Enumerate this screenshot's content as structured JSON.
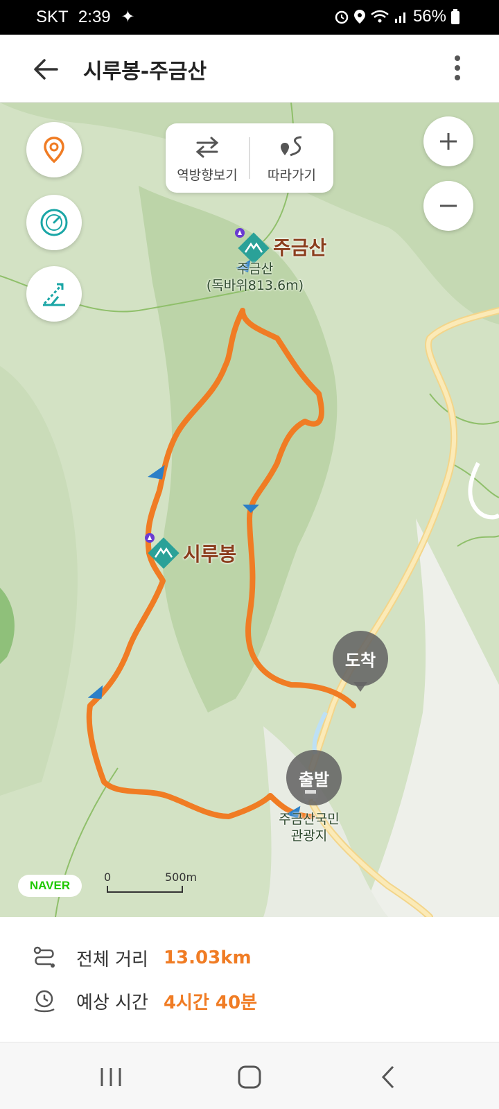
{
  "status": {
    "carrier": "SKT",
    "time": "2:39",
    "battery": "56%"
  },
  "header": {
    "title": "시루봉-주금산"
  },
  "map": {
    "toolbar": {
      "reverse_label": "역방향보기",
      "follow_label": "따라가기"
    },
    "peaks": [
      {
        "name": "주금산"
      },
      {
        "name": "시루봉"
      }
    ],
    "place_labels": {
      "jugeumsan_line1": "주금산",
      "jugeumsan_line2": "(독바위813.6m)",
      "resort_line1": "주금산국민",
      "resort_line2": "관광지"
    },
    "pins": {
      "start": "출발",
      "end": "도착"
    },
    "provider": "NAVER",
    "scale": {
      "zero": "0",
      "distance": "500m"
    },
    "route_color": "#f07c24",
    "peak_color": "#2aa198"
  },
  "summary": {
    "distance_label": "전체 거리",
    "distance_value": "13.03km",
    "time_label": "예상 시간",
    "time_value": "4시간 40분"
  },
  "icons": [
    "back-arrow-icon",
    "more-vertical-icon",
    "location-pin-icon",
    "speedometer-icon",
    "elevation-icon",
    "reverse-icon",
    "follow-icon",
    "plus-icon",
    "minus-icon",
    "distance-icon",
    "clock-icon"
  ]
}
